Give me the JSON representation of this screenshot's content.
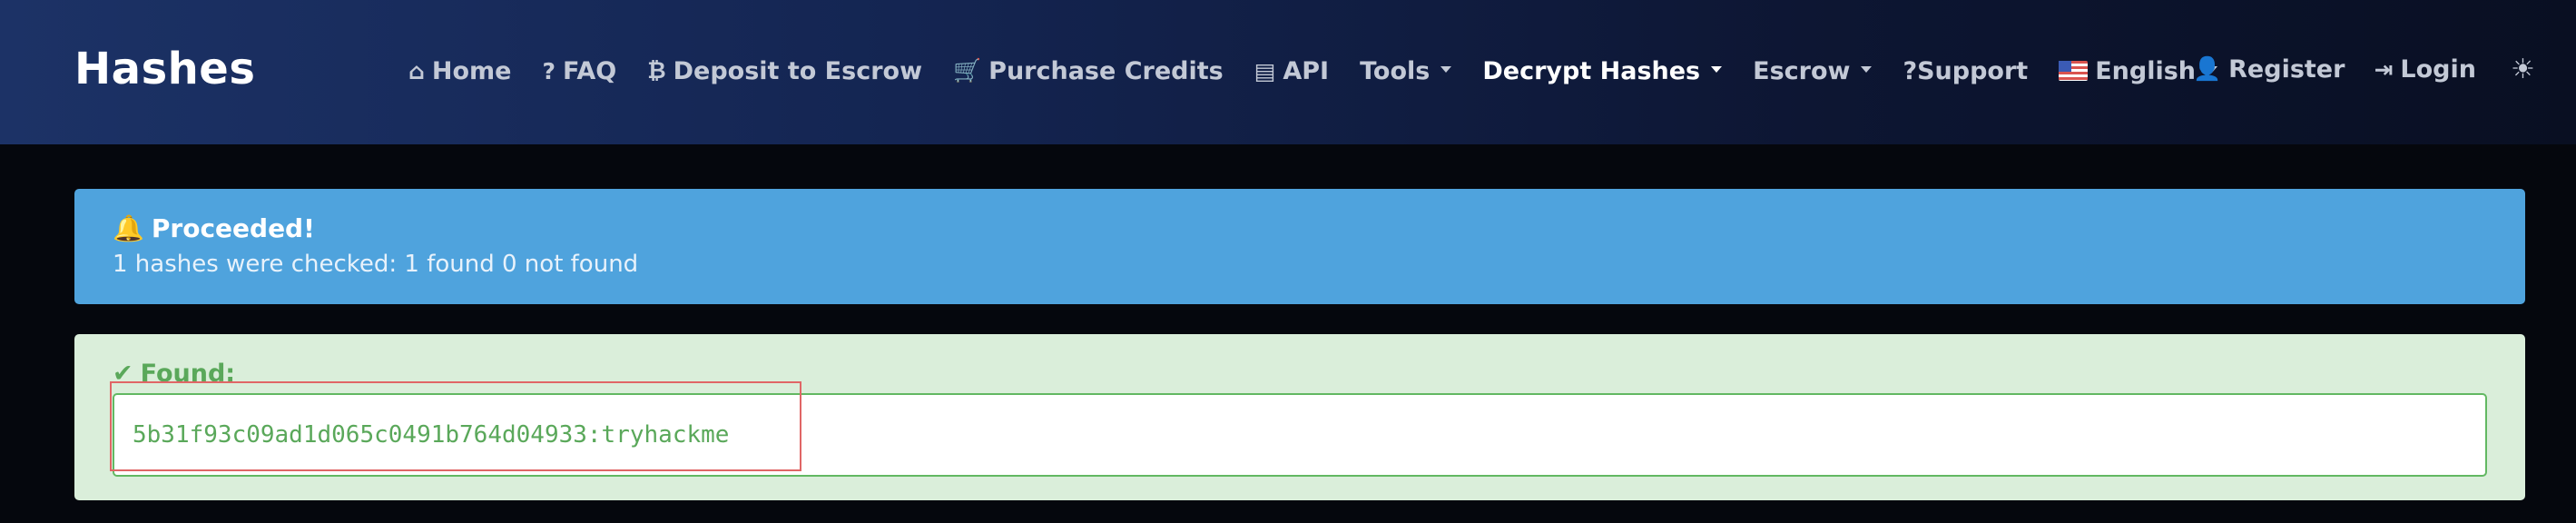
{
  "brand": "Hashes",
  "nav": {
    "home": {
      "icon": "⌂",
      "label": "Home"
    },
    "faq": {
      "icon": "?",
      "label": "FAQ"
    },
    "deposit": {
      "icon": "₿",
      "label": "Deposit to Escrow"
    },
    "purchase": {
      "icon": "🛒",
      "label": "Purchase Credits"
    },
    "api": {
      "icon": "▤",
      "label": "API"
    },
    "tools": {
      "label": "Tools"
    },
    "decrypt": {
      "label": "Decrypt Hashes"
    },
    "escrow": {
      "label": "Escrow"
    },
    "support": {
      "label": "?Support"
    },
    "language": {
      "label": "English"
    },
    "register": {
      "icon": "👤",
      "label": "Register"
    },
    "login": {
      "icon": "⇥",
      "label": "Login"
    },
    "theme": {
      "icon": "☀"
    }
  },
  "alert": {
    "icon": "🔔",
    "title": "Proceeded!",
    "text": "1 hashes were checked: 1 found 0 not found",
    "color": "#4fa3dd"
  },
  "found": {
    "icon": "✔",
    "label": "Found:",
    "value": "5b31f93c09ad1d065c0491b764d04933:tryhackme",
    "color": "#5aa85a"
  }
}
